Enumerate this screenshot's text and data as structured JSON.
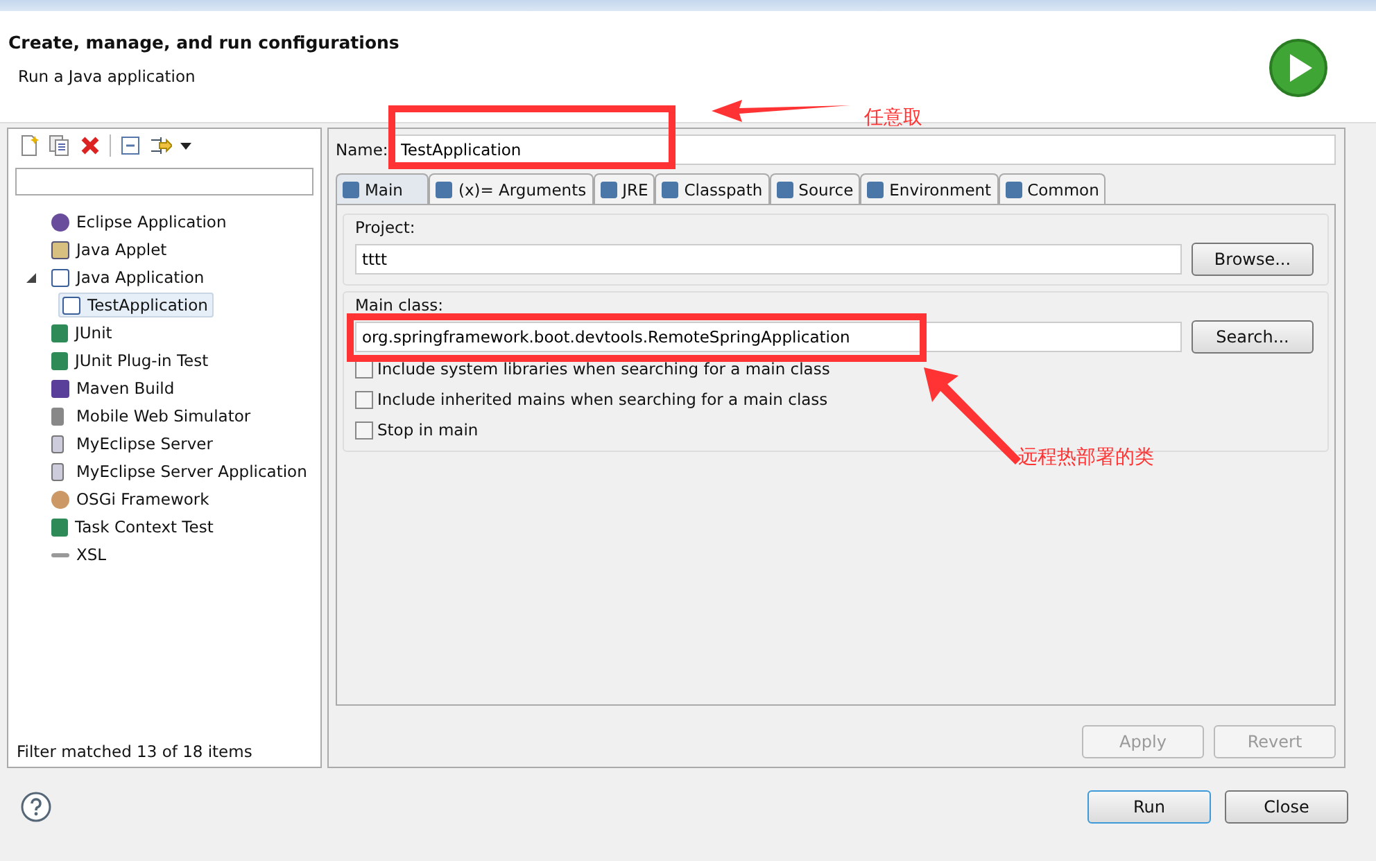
{
  "header": {
    "title": "Create, manage, and run configurations",
    "subtitle": "Run a Java application"
  },
  "sidebar": {
    "tree": [
      {
        "label": "Eclipse Application",
        "kind": "eclipse",
        "selected": false
      },
      {
        "label": "Java Applet",
        "kind": "applet",
        "selected": false
      },
      {
        "label": "Java Application",
        "kind": "java",
        "selected": false,
        "expanded": true,
        "children": [
          {
            "label": "TestApplication",
            "kind": "java",
            "selected": true
          }
        ]
      },
      {
        "label": "JUnit",
        "kind": "junit",
        "selected": false
      },
      {
        "label": "JUnit Plug-in Test",
        "kind": "junit",
        "selected": false
      },
      {
        "label": "Maven Build",
        "kind": "maven",
        "selected": false
      },
      {
        "label": "Mobile Web Simulator",
        "kind": "mobile",
        "selected": false
      },
      {
        "label": "MyEclipse Server",
        "kind": "server",
        "selected": false
      },
      {
        "label": "MyEclipse Server Application",
        "kind": "server",
        "selected": false
      },
      {
        "label": "OSGi Framework",
        "kind": "osgi",
        "selected": false
      },
      {
        "label": "Task Context Test",
        "kind": "junit",
        "selected": false
      },
      {
        "label": "XSL",
        "kind": "xsl",
        "selected": false
      }
    ],
    "status": "Filter matched 13 of 18 items"
  },
  "name": {
    "label": "Name:",
    "value": "TestApplication"
  },
  "tabs": [
    {
      "label": "Main",
      "selected": true
    },
    {
      "label": "(x)= Arguments",
      "selected": false
    },
    {
      "label": "JRE",
      "selected": false
    },
    {
      "label": "Classpath",
      "selected": false
    },
    {
      "label": "Source",
      "selected": false
    },
    {
      "label": "Environment",
      "selected": false
    },
    {
      "label": "Common",
      "selected": false
    }
  ],
  "project": {
    "label": "Project:",
    "value": "tttt",
    "button": "Browse..."
  },
  "main_class": {
    "label": "Main class:",
    "value": "org.springframework.boot.devtools.RemoteSpringApplication",
    "button": "Search..."
  },
  "options": [
    {
      "label": "Include system libraries when searching for a main class",
      "checked": false
    },
    {
      "label": "Include inherited mains when searching for a main class",
      "checked": false
    },
    {
      "label": "Stop in main",
      "checked": false
    }
  ],
  "apply_buttons": [
    {
      "label": "Apply",
      "disabled": true
    },
    {
      "label": "Revert",
      "disabled": true
    }
  ],
  "dialog_buttons": [
    {
      "label": "Run",
      "default": true
    },
    {
      "label": "Close",
      "default": false
    }
  ],
  "annotations": [
    {
      "text": "任意取"
    },
    {
      "text": "远程热部署的类"
    }
  ]
}
